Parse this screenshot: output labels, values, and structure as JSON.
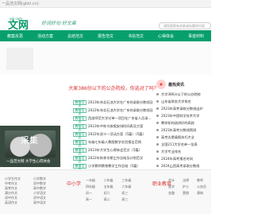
{
  "browser": {
    "url": "一品范文网(gkkl.cn)"
  },
  "header": {
    "logo_main": "文网",
    "logo_small": "ym.com",
    "slogan": "好词好句·好文章",
    "search_placeholder": "请您搜索有关联或标题的内容"
  },
  "nav": [
    "教案反思",
    "活动方案",
    "总结范文",
    "报告范文",
    "书信范文",
    "心得体会",
    "事迹材料"
  ],
  "main": {
    "title": "大家386份以下的公办院校，你选对了吗？",
    "items": [
      {
        "tag": "教育范文",
        "text": "2023年东北石油大学在广东的录取分数线及"
      },
      {
        "tag": "教育范文",
        "text": "2022年东北石油大学在广东的录取分数线及"
      },
      {
        "tag": "教育范文",
        "text": "西部师范大学对单一项目在广东省人员录取分"
      },
      {
        "tag": "教育范文",
        "text": "2023年中秋节放假安排时间表及方案"
      },
      {
        "tag": "教育范文",
        "text": "2022年双十一活动方案（5篇）（5篇）"
      },
      {
        "tag": "教育范文",
        "text": "年级七年级人教版数学实验报告范例"
      },
      {
        "tag": "教育范文",
        "text": "2023年大学生心得体会范文（5篇）"
      },
      {
        "tag": "教育范文",
        "text": "2022年秋季学期工作总结及计划范文"
      },
      {
        "tag": "教育范文",
        "text": "小学教师教育教学工作总结（5篇）"
      }
    ]
  },
  "sidebar": {
    "heading": "最热资讯",
    "items": [
      "大学386分以下的公办院校",
      "山东省财务大学排名",
      "2023年高考录取分数线出炉",
      "2023年中国科学技术大学",
      "教你如何选择好的高校",
      "2023年高考分数线预测",
      "高考志愿填报技巧大全",
      "全国211大学名单一览表",
      "大学专业排名",
      "2024年高考报名时间",
      "2024山西高考录取分数线",
      "公务员考试时间表",
      "大学排名榜单最新版",
      "中考作文范文大全",
      "2024年成人高考"
    ]
  },
  "leftimage": {
    "title": "采集",
    "caption": "一品范文网 大学生心得体会"
  },
  "footer": {
    "col1": [
      "小学生作文",
      "中考作文",
      "高考作文",
      "满分作文",
      "初中作文",
      "英语作文"
    ],
    "col2": [
      "小学数学",
      "初中数学",
      "高中数学",
      "小学语文",
      "初中语文",
      "高中语文"
    ],
    "title_mid": "中小学",
    "grid_mid": [
      "一年级",
      "二年级",
      "三年级",
      "四年级",
      "五年级",
      "六年级",
      "初一",
      "初二",
      "初三",
      "高一",
      "高二",
      "高三"
    ],
    "title_right": "职业教育",
    "grid_right": [
      "会计",
      "法律",
      "教师",
      "医学",
      "护士",
      "公务员",
      "金融",
      "营销",
      "建筑"
    ]
  }
}
